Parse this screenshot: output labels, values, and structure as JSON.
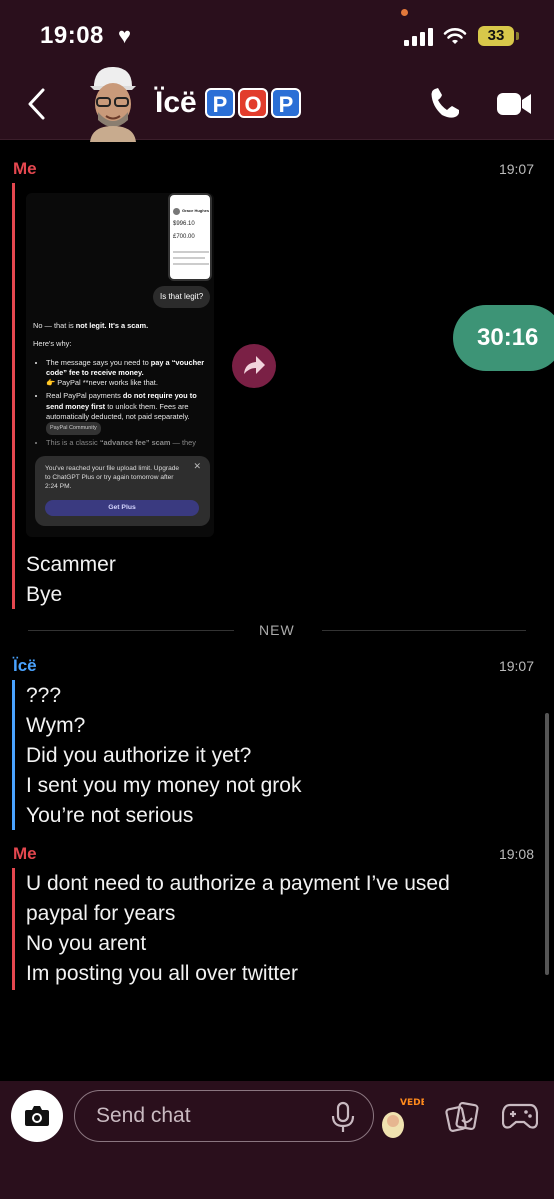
{
  "status_bar": {
    "time": "19:08",
    "battery": "33"
  },
  "header": {
    "contact_name": "Ïcë",
    "badge_letters": [
      "P",
      "O",
      "P"
    ]
  },
  "thread": {
    "group1": {
      "sender": "Me",
      "time": "19:07",
      "screenshot": {
        "card_name": "Grace Hughes",
        "card_amount_1": "$996.10",
        "card_amount_2": "£700.00",
        "bubble": "Is that legit?",
        "answer_intro_normal": "No — that is ",
        "answer_intro_bold": "not legit. It's a scam.",
        "heres_why": "Here's why:",
        "point1_a": "The message says you need to ",
        "point1_b": "pay a “voucher code” fee to receive money.",
        "point1_c": "👉 PayPal **never works like that.",
        "point2_a": "Real PayPal payments ",
        "point2_b": "do not require you to send money first",
        "point2_c": " to unlock them. Fees are automatically deducted, not paid separately.",
        "pill": "PayPal Community",
        "point3_a": "This is a classic ",
        "point3_b": "“advance fee” scam",
        "point3_c": " — they",
        "limit_text": "You've reached your file upload limit. Upgrade to ChatGPT Plus or try again tomorrow after 2:24 PM.",
        "limit_button": "Get Plus"
      },
      "messages": [
        "Scammer",
        "Bye"
      ]
    },
    "timer": "30:16",
    "new_divider": "NEW",
    "group2": {
      "sender": "Ïcë",
      "time": "19:07",
      "messages": [
        "???",
        "Wym?",
        "Did you authorize it yet?",
        "I sent you my money not grok",
        "You’re not serious"
      ]
    },
    "group3": {
      "sender": "Me",
      "time": "19:08",
      "messages": [
        "U dont need to authorize a payment I’ve used",
        "paypal for years",
        "No you arent",
        "Im posting you all over twitter"
      ]
    }
  },
  "bottom_bar": {
    "placeholder": "Send chat",
    "bitmoji_text": "VEDE VIBE"
  },
  "colors": {
    "me": "#e4474f",
    "ice": "#4aa3ff",
    "header_bg": "#2a0f1c",
    "timer_bg": "#3d9476"
  },
  "icons": [
    "heart-icon",
    "signal-icon",
    "wifi-icon",
    "back-chevron-icon",
    "phone-icon",
    "video-icon",
    "share-arrow-icon",
    "camera-icon",
    "microphone-icon",
    "stickers-icon",
    "games-icon"
  ]
}
